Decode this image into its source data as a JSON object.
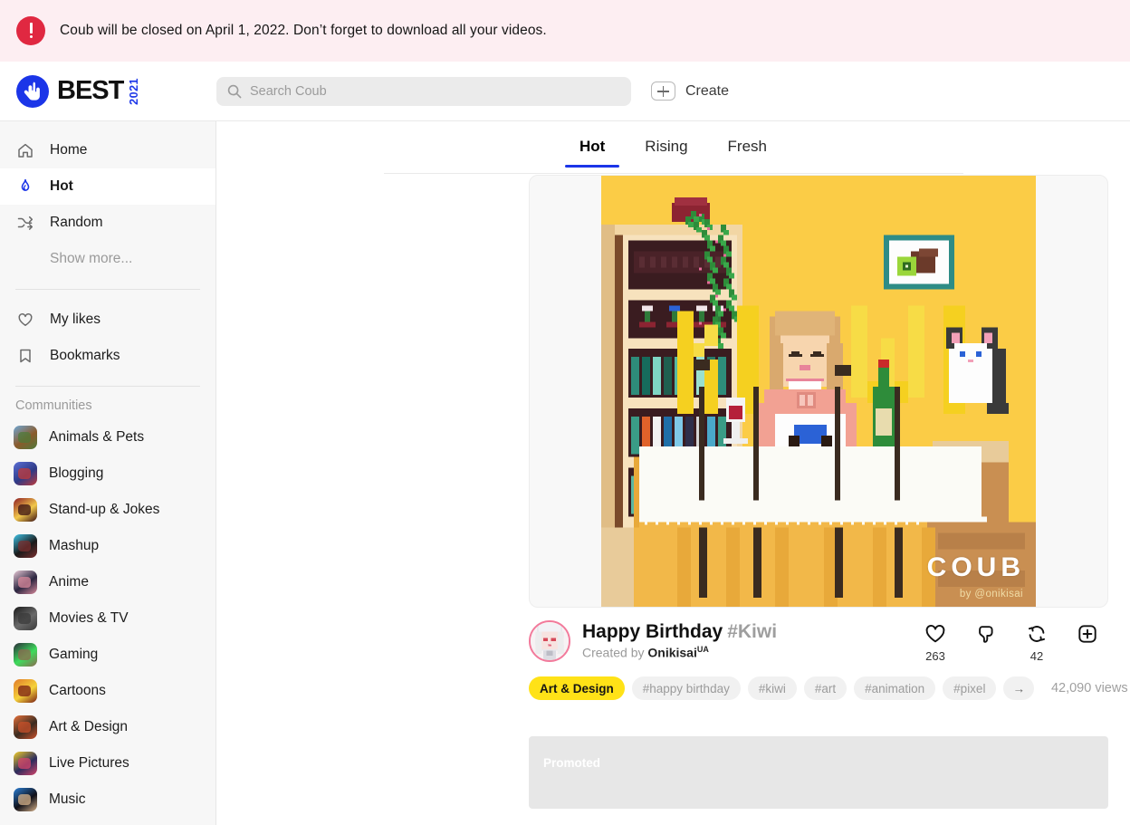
{
  "notice": {
    "icon": "alert-circle-icon",
    "text": "Coub will be closed on April 1, 2022. Don’t forget to download all your videos.",
    "bg": "#fdeef2",
    "icon_color": "#e02841"
  },
  "header": {
    "logo": {
      "word": "BEST",
      "year": "2021",
      "mark": "coub-hand-icon",
      "brand_color": "#1b35e8"
    },
    "search": {
      "icon": "search-icon",
      "placeholder": "Search Coub",
      "value": ""
    },
    "create": {
      "icon": "plus-box-icon",
      "label": "Create"
    }
  },
  "sidebar": {
    "items": [
      {
        "label": "Home",
        "icon": "home-icon",
        "active": false
      },
      {
        "label": "Hot",
        "icon": "flame-icon",
        "active": true
      },
      {
        "label": "Random",
        "icon": "shuffle-icon",
        "active": false
      },
      {
        "label": "Show more...",
        "icon": "",
        "active": false,
        "muted": true
      }
    ],
    "items2": [
      {
        "label": "My likes",
        "icon": "heart-icon"
      },
      {
        "label": "Bookmarks",
        "icon": "bookmark-icon"
      }
    ],
    "communities_label": "Communities",
    "communities": [
      {
        "label": "Animals & Pets",
        "icon": "animals-pets-thumb",
        "c1": "#6fa8d6",
        "c2": "#8b5a2b",
        "c3": "#4f7a3a"
      },
      {
        "label": "Blogging",
        "icon": "blogging-thumb",
        "c1": "#5b6fd6",
        "c2": "#2e3a86",
        "c3": "#c23b3b"
      },
      {
        "label": "Stand-up & Jokes",
        "icon": "standup-jokes-thumb",
        "c1": "#8e1d24",
        "c2": "#f2c84b",
        "c3": "#3a1113"
      },
      {
        "label": "Mashup",
        "icon": "mashup-thumb",
        "c1": "#3fc6ea",
        "c2": "#1a1a1a",
        "c3": "#7a2f2f"
      },
      {
        "label": "Anime",
        "icon": "anime-thumb",
        "c1": "#e8c9d6",
        "c2": "#2b2640",
        "c3": "#d98a9c"
      },
      {
        "label": "Movies & TV",
        "icon": "movies-tv-thumb",
        "c1": "#1a1a1a",
        "c2": "#6a6a6a",
        "c3": "#3b3b3b"
      },
      {
        "label": "Gaming",
        "icon": "gaming-thumb",
        "c1": "#2a2a38",
        "c2": "#3ddc5c",
        "c3": "#8d6a4f"
      },
      {
        "label": "Cartoons",
        "icon": "cartoons-thumb",
        "c1": "#e07a2a",
        "c2": "#f5d23a",
        "c3": "#7a1f14"
      },
      {
        "label": "Art & Design",
        "icon": "art-design-thumb",
        "c1": "#e8713a",
        "c2": "#3a2b20",
        "c3": "#c9502a"
      },
      {
        "label": "Live Pictures",
        "icon": "live-pictures-thumb",
        "c1": "#f2cf2c",
        "c2": "#2b2b5c",
        "c3": "#d6456b"
      },
      {
        "label": "Music",
        "icon": "music-thumb",
        "c1": "#2b7fd6",
        "c2": "#101018",
        "c3": "#d6b28a"
      }
    ]
  },
  "feed": {
    "tabs": [
      {
        "label": "Hot",
        "active": true
      },
      {
        "label": "Rising",
        "active": false
      },
      {
        "label": "Fresh",
        "active": false
      }
    ],
    "post": {
      "title": "Happy Birthday",
      "title_tag": "#Kiwi",
      "created_by_prefix": "Created by",
      "author": "Onikisai",
      "author_flag": "UA",
      "avatar": "user-avatar",
      "watermark": "COUB",
      "watermark_byline": "by @onikisai",
      "views": "42,090 views",
      "actions": [
        {
          "icon": "heart-icon",
          "name": "like-button",
          "count": "263"
        },
        {
          "icon": "thumbs-down-icon",
          "name": "dislike-button",
          "count": ""
        },
        {
          "icon": "recoub-icon",
          "name": "recoub-button",
          "count": "42"
        },
        {
          "icon": "plus-box-icon",
          "name": "bookmark-button",
          "count": ""
        }
      ],
      "tags": [
        {
          "label": "Art & Design",
          "primary": true
        },
        {
          "label": "#happy birthday",
          "primary": false
        },
        {
          "label": "#kiwi",
          "primary": false
        },
        {
          "label": "#art",
          "primary": false
        },
        {
          "label": "#animation",
          "primary": false
        },
        {
          "label": "#pixel",
          "primary": false
        },
        {
          "label": "→",
          "primary": false,
          "arrow": true
        }
      ]
    },
    "promoted_label": "Promoted"
  },
  "colors": {
    "accent_blue": "#1b35e8",
    "tag_yellow": "#ffe217",
    "alert_red": "#e02841",
    "scene_wall": "#fbcc46"
  }
}
